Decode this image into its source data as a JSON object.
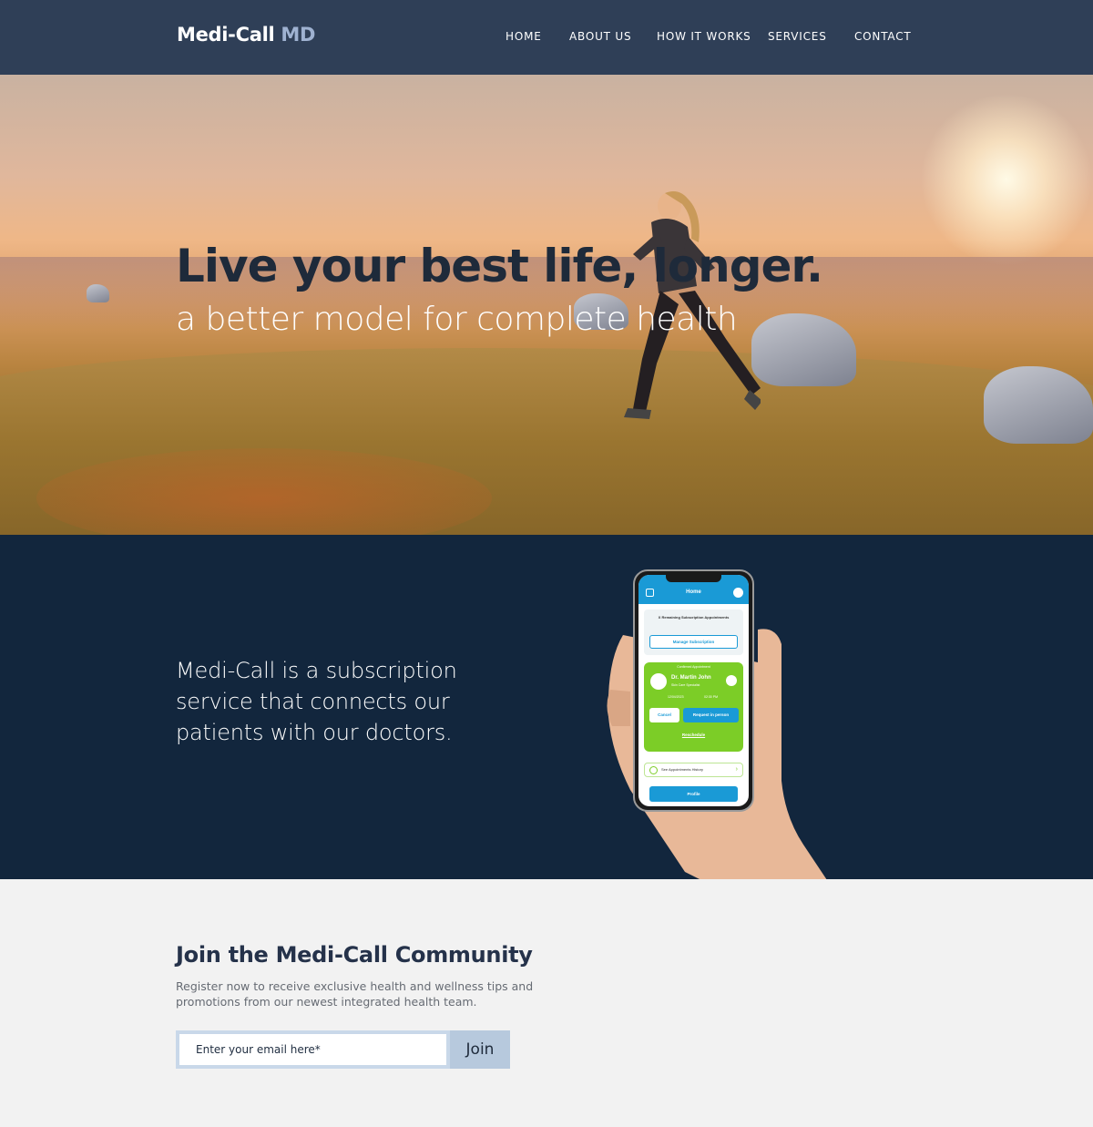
{
  "brand": {
    "name": "Medi-Call",
    "suffix": "MD",
    "suffix_color": "#9fb2d1"
  },
  "nav": {
    "items": [
      {
        "label": "HOME"
      },
      {
        "label": "ABOUT US"
      },
      {
        "label": "HOW IT WORKS"
      },
      {
        "label": "SERVICES"
      },
      {
        "label": "CONTACT"
      }
    ]
  },
  "hero": {
    "title": "Live your best life, longer.",
    "subtitle": "a better model for complete health"
  },
  "intro": {
    "text": "Medi-Call is a subscription service that connects our patients with our doctors."
  },
  "phone_app": {
    "header_title": "Home",
    "subscription_text": "X Remaining Subscription Appointments",
    "manage_button": "Manage Subscription",
    "confirmed_label": "Confirmed Appointment",
    "doctor_name": "Dr. Martin John",
    "doctor_specialty": "Skin Care Specialist",
    "date": "12/04/2023",
    "time": "02:30 PM",
    "cancel_button": "Cancel",
    "request_button": "Request in person",
    "reschedule_link": "Reschedule",
    "history_link": "See Appointments History",
    "profile_button": "Profile"
  },
  "join": {
    "title": "Join the Medi-Call Community",
    "description": "Register now to receive exclusive health and wellness  tips and promotions from our newest integrated health team.",
    "email_placeholder": "Enter your email here*",
    "button_label": "Join"
  },
  "colors": {
    "header_bg": "#2f3f57",
    "dark_section_bg": "#12263d",
    "page_bg": "#f2f2f2",
    "app_blue": "#1a9ad6",
    "app_green": "#7ccd27"
  }
}
